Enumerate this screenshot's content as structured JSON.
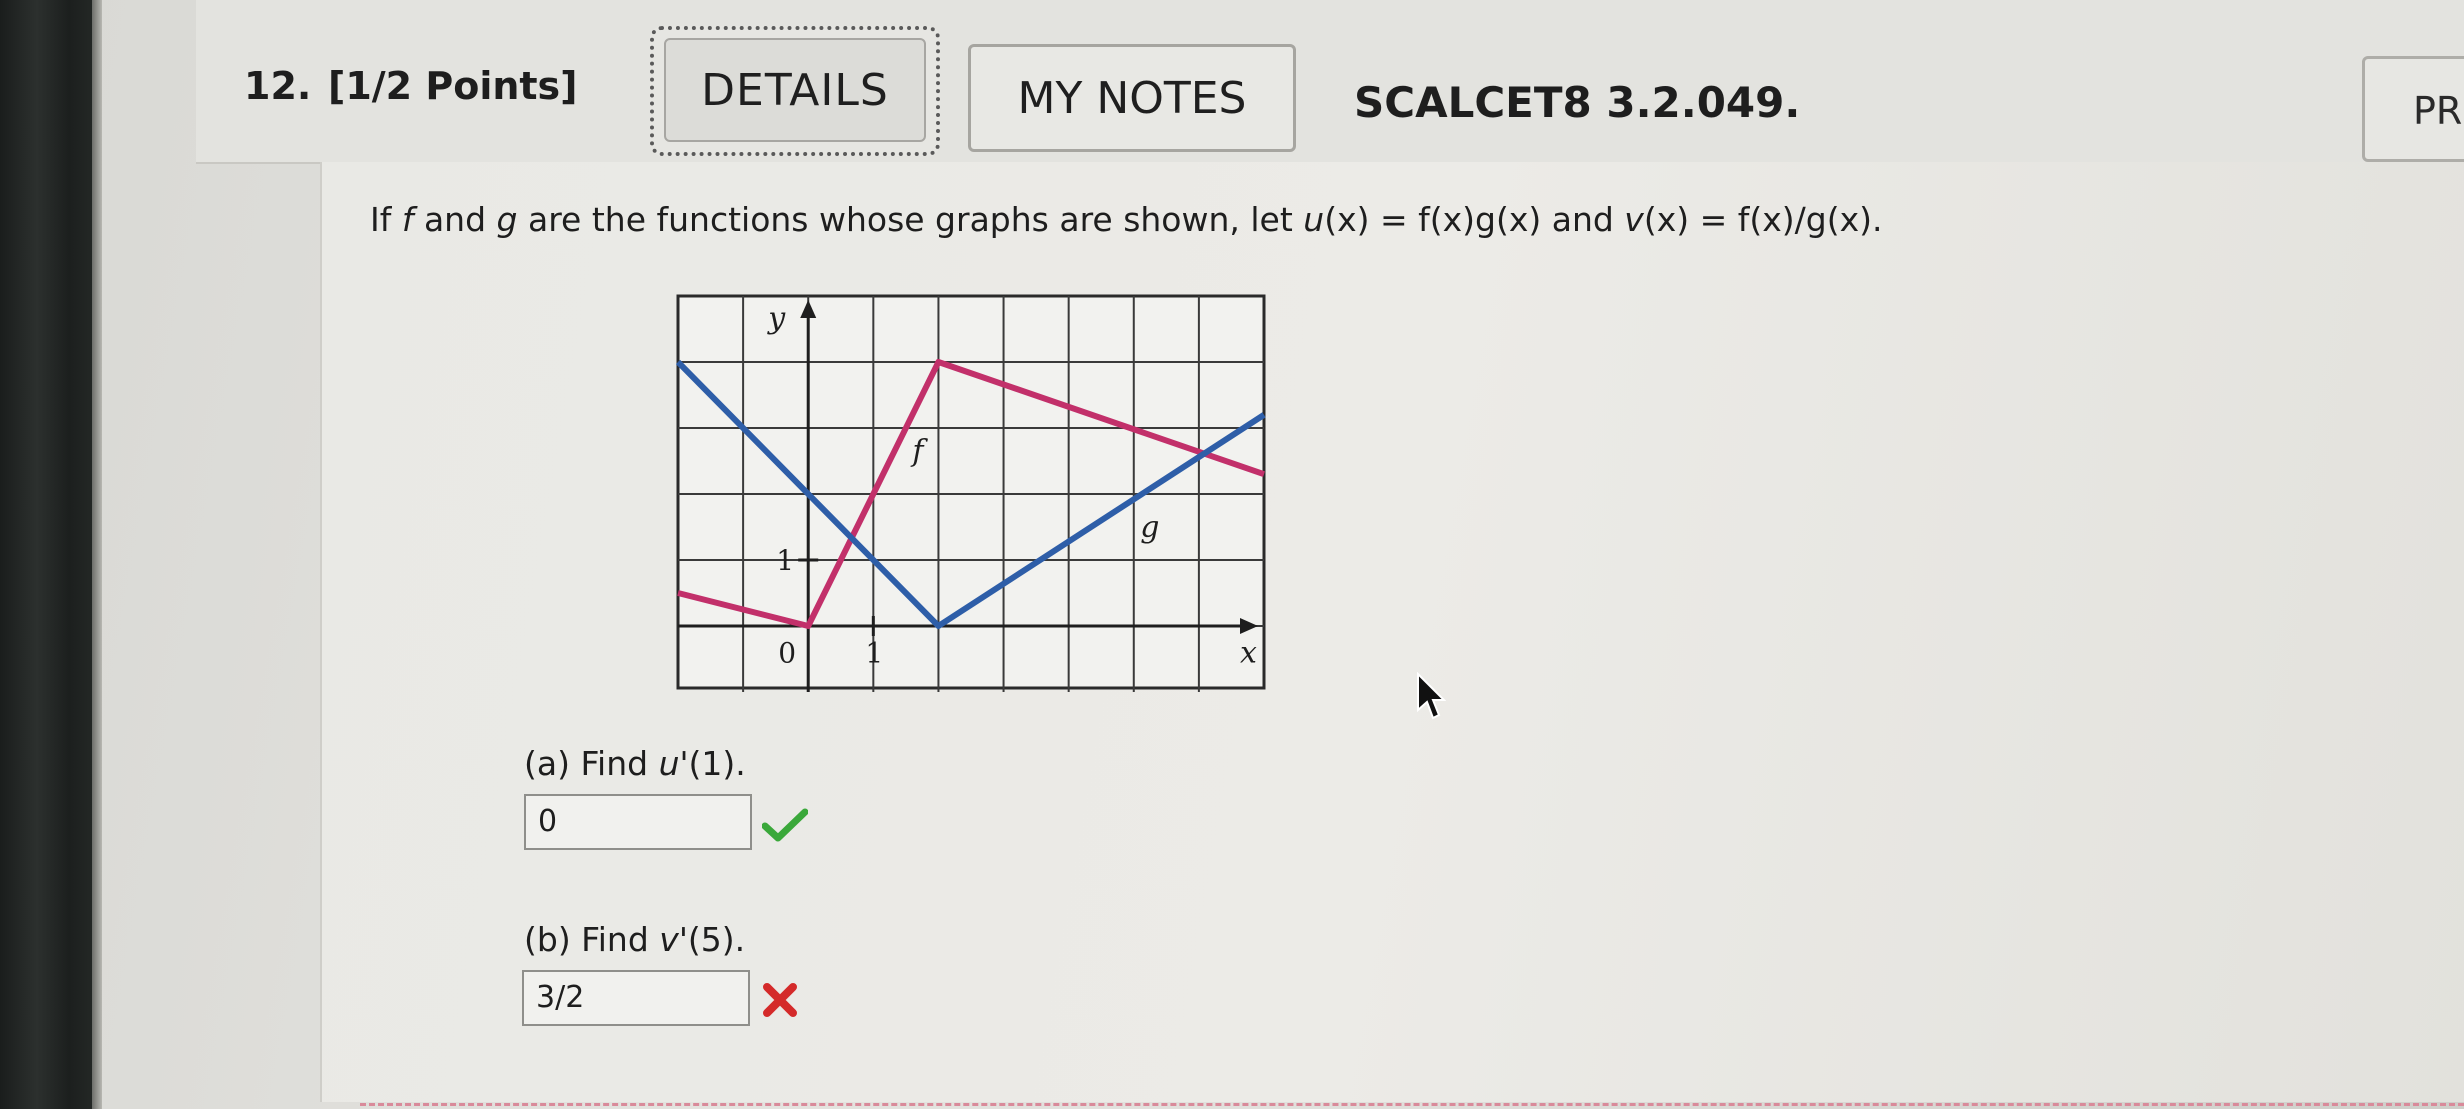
{
  "question": {
    "number": "12.",
    "points": "[1/2 Points]",
    "details_label": "DETAILS",
    "notes_label": "MY NOTES",
    "source": "SCALCET8 3.2.049.",
    "pr_label": "PR"
  },
  "prompt": {
    "t1": "If ",
    "f": "f",
    "t2": " and ",
    "g": "g",
    "t3": " are the functions whose graphs are shown, let ",
    "u": "u",
    "t4": "(x) = f(x)g(x) and ",
    "v": "v",
    "t5": "(x) = f(x)/g(x)."
  },
  "graph": {
    "y_label": "y",
    "x_label": "x",
    "tick_one_y": "1",
    "tick_one_x": "1",
    "origin": "0",
    "f_label": "f",
    "g_label": "g",
    "f_color": "#c2306a",
    "g_color": "#2e5ea8",
    "chart_data": {
      "type": "line",
      "x_range": [
        -2,
        7
      ],
      "y_range": [
        -1,
        5
      ],
      "grid": true,
      "series": [
        {
          "name": "f",
          "x": [
            -2,
            0,
            2,
            7
          ],
          "y": [
            0.5,
            0,
            4,
            2.3
          ]
        },
        {
          "name": "g",
          "x": [
            -2,
            2,
            7
          ],
          "y": [
            4,
            0,
            3.2
          ]
        }
      ]
    }
  },
  "parts": {
    "a": {
      "label": "(a) Find ",
      "fn": "u",
      "rest": "'(1).",
      "answer": "0",
      "status": "correct",
      "status_color": "#3aa83a"
    },
    "b": {
      "label": "(b) Find ",
      "fn": "v",
      "rest": "'(5).",
      "answer": "3/2",
      "status": "incorrect",
      "status_color": "#d42a2a"
    }
  }
}
